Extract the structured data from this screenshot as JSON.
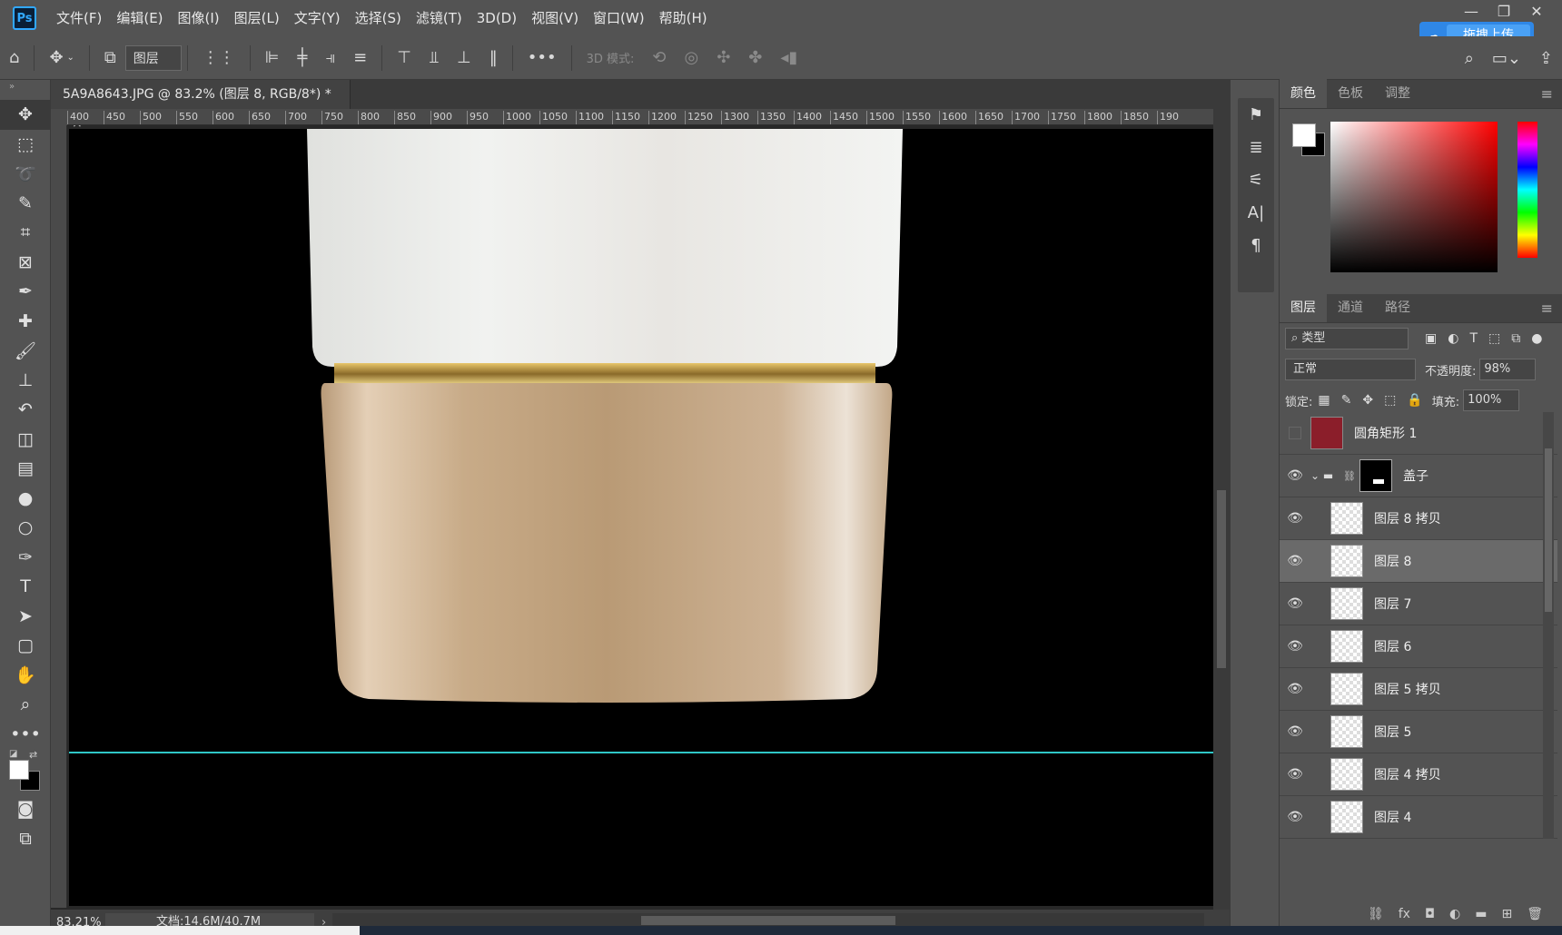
{
  "menubar": {
    "logo": "Ps",
    "items": [
      "文件(F)",
      "编辑(E)",
      "图像(I)",
      "图层(L)",
      "文字(Y)",
      "选择(S)",
      "滤镜(T)",
      "3D(D)",
      "视图(V)",
      "窗口(W)",
      "帮助(H)"
    ],
    "upload_label": "拖拽上传"
  },
  "options": {
    "layer_select": "图层",
    "mode_3d": "3D 模式:"
  },
  "document": {
    "tab_title": "5A9A8643.JPG @ 83.2% (图层 8, RGB/8*) *",
    "close": "×",
    "ruler_ticks": [
      "400",
      "450",
      "500",
      "550",
      "600",
      "650",
      "700",
      "750",
      "800",
      "850",
      "900",
      "950",
      "1000",
      "1050",
      "1100",
      "1150",
      "1200",
      "1250",
      "1300",
      "1350",
      "1400",
      "1450",
      "1500",
      "1550",
      "1600",
      "1650",
      "1700",
      "1750",
      "1800",
      "1850",
      "190"
    ],
    "zoom": "83.21%",
    "docinfo": "文档:14.6M/40.7M",
    "arrow": "›"
  },
  "color_panel": {
    "tabs": [
      "颜色",
      "色板",
      "调整"
    ],
    "foreground": "#ffffff",
    "background": "#000000"
  },
  "layers_panel": {
    "tabs": [
      "图层",
      "通道",
      "路径"
    ],
    "kind_filter": "类型",
    "blend_mode": "正常",
    "opacity_label": "不透明度:",
    "opacity_value": "98%",
    "lock_label": "锁定:",
    "fill_label": "填充:",
    "fill_value": "100%",
    "layers": [
      {
        "name": "圆角矩形 1",
        "visible": false,
        "thumb": "red",
        "indent": 0
      },
      {
        "name": "盖子",
        "visible": true,
        "thumb": "group",
        "indent": 0
      },
      {
        "name": "图层 8 拷贝",
        "visible": true,
        "thumb": "checker",
        "indent": 1
      },
      {
        "name": "图层 8",
        "visible": true,
        "thumb": "checker",
        "indent": 1,
        "selected": true
      },
      {
        "name": "图层 7",
        "visible": true,
        "thumb": "checker",
        "indent": 1
      },
      {
        "name": "图层 6",
        "visible": true,
        "thumb": "checker",
        "indent": 1
      },
      {
        "name": "图层 5 拷贝",
        "visible": true,
        "thumb": "checker",
        "indent": 1
      },
      {
        "name": "图层 5",
        "visible": true,
        "thumb": "checker",
        "indent": 1
      },
      {
        "name": "图层 4 拷贝",
        "visible": true,
        "thumb": "checker",
        "indent": 1
      },
      {
        "name": "图层 4",
        "visible": true,
        "thumb": "checker",
        "indent": 1
      }
    ]
  },
  "colors": {
    "accent": "#31a8ff",
    "guide": "#2fc7c7",
    "cap_gold": "#c4a583"
  }
}
